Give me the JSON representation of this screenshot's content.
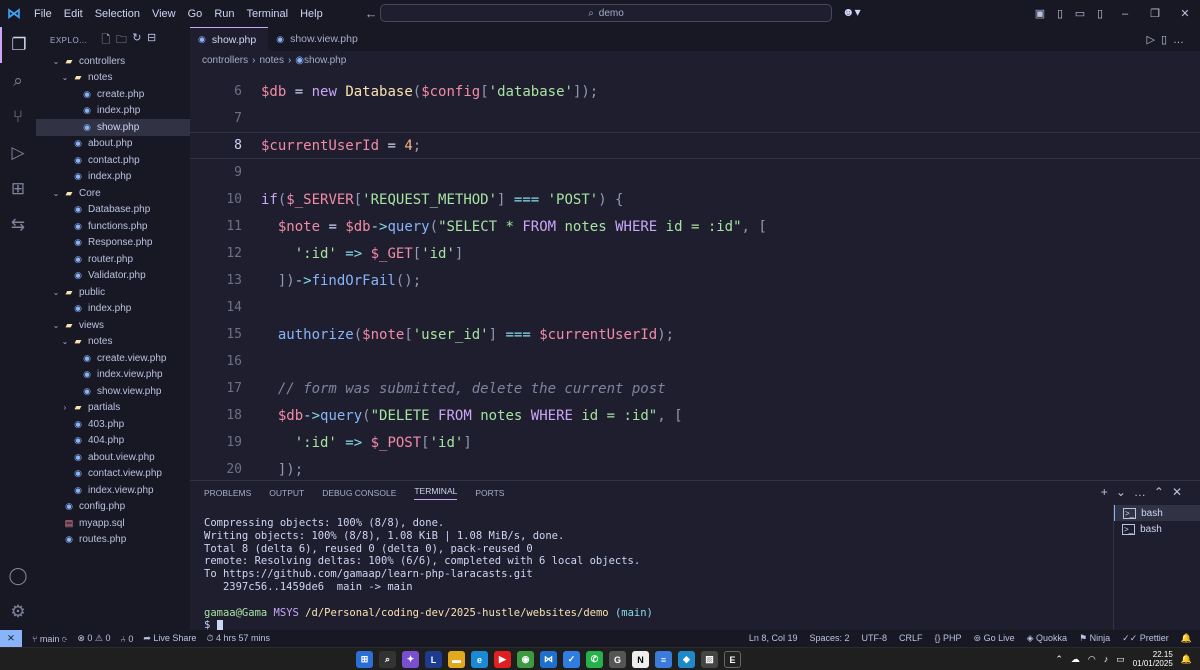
{
  "menu": [
    "File",
    "Edit",
    "Selection",
    "View",
    "Go",
    "Run",
    "Terminal",
    "Help"
  ],
  "search": {
    "text": "demo"
  },
  "sidebar": {
    "title": "EXPLO...",
    "tree": [
      {
        "label": "controllers",
        "type": "folder",
        "depth": 0,
        "open": true
      },
      {
        "label": "notes",
        "type": "folder",
        "depth": 1,
        "open": true
      },
      {
        "label": "create.php",
        "type": "php",
        "depth": 2
      },
      {
        "label": "index.php",
        "type": "php",
        "depth": 2
      },
      {
        "label": "show.php",
        "type": "php",
        "depth": 2,
        "selected": true
      },
      {
        "label": "about.php",
        "type": "php",
        "depth": 1
      },
      {
        "label": "contact.php",
        "type": "php",
        "depth": 1
      },
      {
        "label": "index.php",
        "type": "php",
        "depth": 1
      },
      {
        "label": "Core",
        "type": "folder",
        "depth": 0,
        "open": true
      },
      {
        "label": "Database.php",
        "type": "php",
        "depth": 1
      },
      {
        "label": "functions.php",
        "type": "php",
        "depth": 1
      },
      {
        "label": "Response.php",
        "type": "php",
        "depth": 1
      },
      {
        "label": "router.php",
        "type": "php",
        "depth": 1
      },
      {
        "label": "Validator.php",
        "type": "php",
        "depth": 1
      },
      {
        "label": "public",
        "type": "folder",
        "depth": 0,
        "open": true
      },
      {
        "label": "index.php",
        "type": "php",
        "depth": 1
      },
      {
        "label": "views",
        "type": "folder",
        "depth": 0,
        "open": true
      },
      {
        "label": "notes",
        "type": "folder",
        "depth": 1,
        "open": true
      },
      {
        "label": "create.view.php",
        "type": "php",
        "depth": 2
      },
      {
        "label": "index.view.php",
        "type": "php",
        "depth": 2
      },
      {
        "label": "show.view.php",
        "type": "php",
        "depth": 2
      },
      {
        "label": "partials",
        "type": "folder",
        "depth": 1,
        "open": false
      },
      {
        "label": "403.php",
        "type": "php",
        "depth": 1
      },
      {
        "label": "404.php",
        "type": "php",
        "depth": 1
      },
      {
        "label": "about.view.php",
        "type": "php",
        "depth": 1
      },
      {
        "label": "contact.view.php",
        "type": "php",
        "depth": 1
      },
      {
        "label": "index.view.php",
        "type": "php",
        "depth": 1
      },
      {
        "label": "config.php",
        "type": "php",
        "depth": 0
      },
      {
        "label": "myapp.sql",
        "type": "sql",
        "depth": 0
      },
      {
        "label": "routes.php",
        "type": "php",
        "depth": 0
      }
    ]
  },
  "tabs": [
    {
      "label": "show.php",
      "active": true
    },
    {
      "label": "show.view.php",
      "active": false
    }
  ],
  "breadcrumb": [
    "controllers",
    "notes",
    "show.php"
  ],
  "code": {
    "current_line": 8,
    "lines": [
      {
        "n": "6",
        "tokens": [
          [
            "v",
            "$db"
          ],
          [
            "w",
            " = "
          ],
          [
            "k",
            "new"
          ],
          [
            "w",
            " "
          ],
          [
            "t",
            "Database"
          ],
          [
            "p",
            "("
          ],
          [
            "v",
            "$config"
          ],
          [
            "p",
            "["
          ],
          [
            "s",
            "'database'"
          ],
          [
            "p",
            "]);"
          ]
        ]
      },
      {
        "n": "7",
        "tokens": []
      },
      {
        "n": "8",
        "tokens": [
          [
            "v",
            "$currentUserId"
          ],
          [
            "w",
            " = "
          ],
          [
            "n",
            "4"
          ],
          [
            "p",
            ";"
          ]
        ]
      },
      {
        "n": "9",
        "tokens": []
      },
      {
        "n": "10",
        "tokens": [
          [
            "k",
            "if"
          ],
          [
            "p",
            "("
          ],
          [
            "v",
            "$_SERVER"
          ],
          [
            "p",
            "["
          ],
          [
            "s",
            "'REQUEST_METHOD'"
          ],
          [
            "p",
            "]"
          ],
          [
            "o",
            " === "
          ],
          [
            "s",
            "'POST'"
          ],
          [
            "p",
            ") {"
          ]
        ]
      },
      {
        "n": "11",
        "tokens": [
          [
            "w",
            "  "
          ],
          [
            "v",
            "$note"
          ],
          [
            "w",
            " = "
          ],
          [
            "v",
            "$db"
          ],
          [
            "o",
            "->"
          ],
          [
            "f",
            "query"
          ],
          [
            "p",
            "("
          ],
          [
            "s",
            "\"SELECT * "
          ],
          [
            "k",
            "FROM"
          ],
          [
            "s",
            " notes "
          ],
          [
            "k",
            "WHERE"
          ],
          [
            "s",
            " id = :id\""
          ],
          [
            "p",
            ", ["
          ]
        ]
      },
      {
        "n": "12",
        "tokens": [
          [
            "w",
            "    "
          ],
          [
            "s",
            "':id'"
          ],
          [
            "o",
            " => "
          ],
          [
            "v",
            "$_GET"
          ],
          [
            "p",
            "["
          ],
          [
            "s",
            "'id'"
          ],
          [
            "p",
            "]"
          ]
        ]
      },
      {
        "n": "13",
        "tokens": [
          [
            "w",
            "  "
          ],
          [
            "p",
            "])"
          ],
          [
            "o",
            "->"
          ],
          [
            "f",
            "findOrFail"
          ],
          [
            "p",
            "();"
          ]
        ]
      },
      {
        "n": "14",
        "tokens": []
      },
      {
        "n": "15",
        "tokens": [
          [
            "w",
            "  "
          ],
          [
            "f",
            "authorize"
          ],
          [
            "p",
            "("
          ],
          [
            "v",
            "$note"
          ],
          [
            "p",
            "["
          ],
          [
            "s",
            "'user_id'"
          ],
          [
            "p",
            "]"
          ],
          [
            "o",
            " === "
          ],
          [
            "v",
            "$currentUserId"
          ],
          [
            "p",
            ");"
          ]
        ]
      },
      {
        "n": "16",
        "tokens": []
      },
      {
        "n": "17",
        "tokens": [
          [
            "w",
            "  "
          ],
          [
            "c",
            "// form was submitted, delete the current post"
          ]
        ]
      },
      {
        "n": "18",
        "tokens": [
          [
            "w",
            "  "
          ],
          [
            "v",
            "$db"
          ],
          [
            "o",
            "->"
          ],
          [
            "f",
            "query"
          ],
          [
            "p",
            "("
          ],
          [
            "s",
            "\"DELETE "
          ],
          [
            "k",
            "FROM"
          ],
          [
            "s",
            " notes "
          ],
          [
            "k",
            "WHERE"
          ],
          [
            "s",
            " id = :id\""
          ],
          [
            "p",
            ", ["
          ]
        ]
      },
      {
        "n": "19",
        "tokens": [
          [
            "w",
            "    "
          ],
          [
            "s",
            "':id'"
          ],
          [
            "o",
            " => "
          ],
          [
            "v",
            "$_POST"
          ],
          [
            "p",
            "["
          ],
          [
            "s",
            "'id'"
          ],
          [
            "p",
            "]"
          ]
        ]
      },
      {
        "n": "20",
        "tokens": [
          [
            "w",
            "  "
          ],
          [
            "p",
            "]);"
          ]
        ]
      }
    ]
  },
  "panel": {
    "tabs": [
      "PROBLEMS",
      "OUTPUT",
      "DEBUG CONSOLE",
      "TERMINAL",
      "PORTS"
    ],
    "active_tab": "TERMINAL",
    "terminal_lines": [
      "Compressing objects: 100% (8/8), done.",
      "Writing objects: 100% (8/8), 1.08 KiB | 1.08 MiB/s, done.",
      "Total 8 (delta 6), reused 0 (delta 0), pack-reused 0",
      "remote: Resolving deltas: 100% (6/6), completed with 6 local objects.",
      "To https://github.com/gamaap/learn-php-laracasts.git",
      "   2397c56..1459de6  main -> main",
      ""
    ],
    "prompt": {
      "user": "gamaa@Gama",
      "env": "MSYS",
      "path": "/d/Personal/coding-dev/2025-hustle/websites/demo",
      "branch": "(main)",
      "symbol": "$"
    },
    "shells": [
      "bash",
      "bash"
    ]
  },
  "status": {
    "branch": "main",
    "problems": "⊗ 0 ⚠ 0",
    "ports": "⑃ 0",
    "live_share": "Live Share",
    "time_tracked": "4 hrs 57 mins",
    "cursor": "Ln 8, Col 19",
    "spaces": "Spaces: 2",
    "encoding": "UTF-8",
    "eol": "CRLF",
    "language": "PHP",
    "golive": "Go Live",
    "quokka": "Quokka",
    "ninja": "Ninja",
    "prettier": "Prettier"
  },
  "taskbar": {
    "time": "22.15",
    "date": "01/01/2025"
  }
}
